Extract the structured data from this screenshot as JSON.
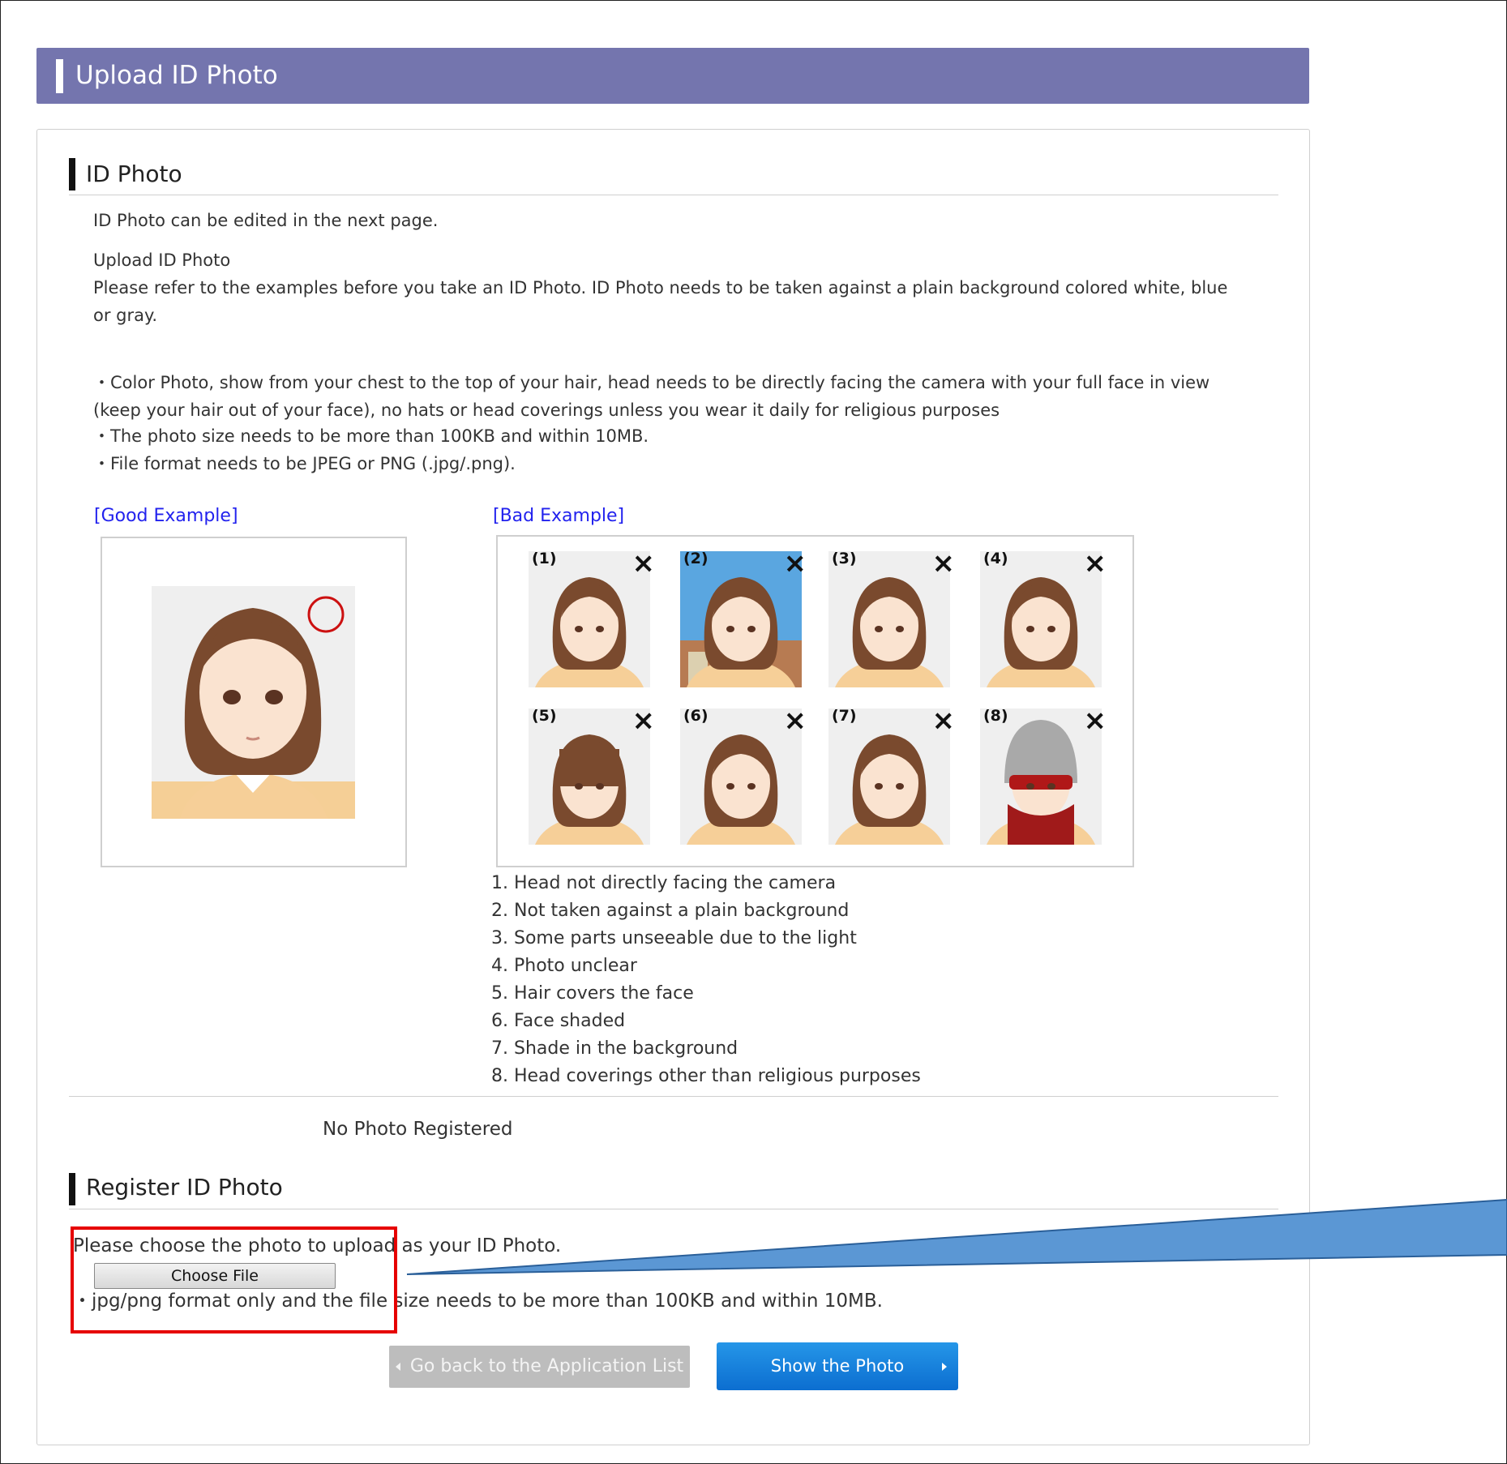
{
  "header": {
    "title": "Upload ID Photo"
  },
  "id_photo_section": {
    "title": "ID Photo",
    "edit_note": "ID Photo can be edited in the next page.",
    "upload_heading": "Upload ID Photo",
    "intro_line1": "Please refer to the examples before you take an ID Photo. ID Photo needs to be taken against a plain background colored white, blue",
    "intro_line2": "or gray.",
    "req1_line1": "・Color Photo, show from your chest to the top of your hair, head needs to be directly facing the camera with your full face in view",
    "req1_line2": "(keep your hair out of your face), no hats or head coverings unless you wear it daily for religious purposes",
    "req2": "・The photo size needs to be more than 100KB and within 10MB.",
    "req3": "・File format needs to be JPEG or PNG (.jpg/.png).",
    "good_label": "[Good Example]",
    "bad_label": "[Bad Example]",
    "bad_thumbs": [
      {
        "num": "(1)",
        "mark": "×"
      },
      {
        "num": "(2)",
        "mark": "×"
      },
      {
        "num": "(3)",
        "mark": "×"
      },
      {
        "num": "(4)",
        "mark": "×"
      },
      {
        "num": "(5)",
        "mark": "×"
      },
      {
        "num": "(6)",
        "mark": "×"
      },
      {
        "num": "(7)",
        "mark": "×"
      },
      {
        "num": "(8)",
        "mark": "×"
      }
    ],
    "bad_reasons": [
      "1. Head not directly facing the camera",
      "2. Not taken against a plain background",
      "3. Some parts unseeable due to the light",
      "4. Photo unclear",
      "5. Hair covers the face",
      "6. Face shaded",
      "7. Shade in the background",
      "8. Head coverings other than religious purposes"
    ],
    "no_photo": "No Photo Registered"
  },
  "register_section": {
    "title": "Register ID Photo",
    "instruction": "Please choose the photo to upload as your ID Photo.",
    "choose_file": "Choose File",
    "format_note": "・jpg/png format only and the file size needs to be more than 100KB and within 10MB."
  },
  "buttons": {
    "back": "Go back to the Application List",
    "show": "Show the Photo"
  },
  "colors": {
    "header_bg": "#7475ae",
    "link": "#2222ee",
    "primary_button": "#1481de",
    "highlight": "#e60000",
    "callout": "#5b97d4"
  }
}
